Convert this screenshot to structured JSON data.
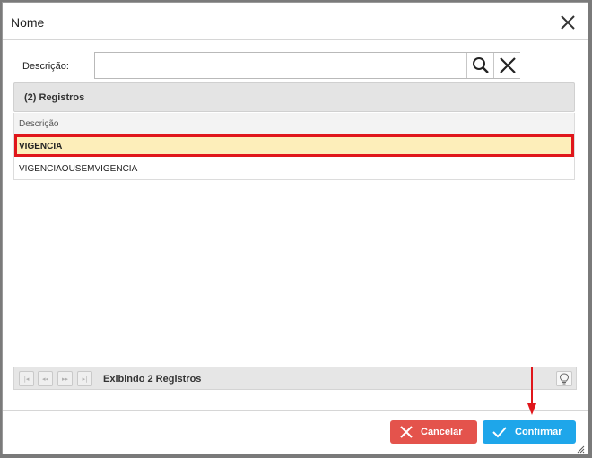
{
  "dialog": {
    "title": "Nome"
  },
  "search": {
    "label": "Descrição:",
    "value": "",
    "placeholder": ""
  },
  "grid": {
    "header": "(2) Registros",
    "column": "Descrição",
    "rows": [
      {
        "label": "VIGENCIA",
        "selected": true
      },
      {
        "label": "VIGENCIAOUSEMVIGENCIA",
        "selected": false
      }
    ]
  },
  "pager": {
    "first": "|◂",
    "prev": "◂◂",
    "next": "▸▸",
    "last": "▸|",
    "status": "Exibindo 2 Registros"
  },
  "buttons": {
    "cancel": "Cancelar",
    "confirm": "Confirmar"
  },
  "colors": {
    "cancel": "#e4534c",
    "confirm": "#1ea6ea",
    "selected_row_bg": "#fdeeba",
    "highlight_border": "#e0161b",
    "annotation_arrow": "#e0161b"
  },
  "icons": {
    "close": "close-icon",
    "search": "search-icon",
    "clear": "clear-icon",
    "bulb": "lightbulb-icon",
    "cancel": "x-icon",
    "confirm": "check-icon"
  }
}
